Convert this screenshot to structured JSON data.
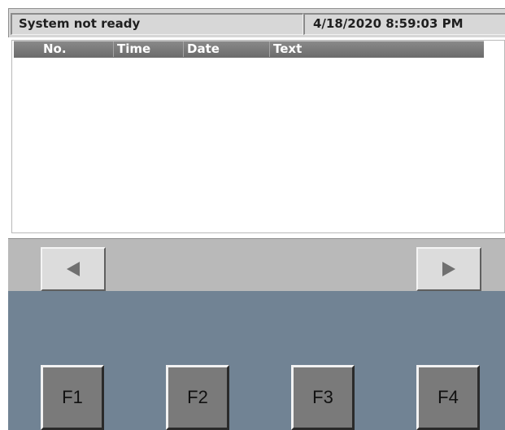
{
  "status_bar": {
    "status_text": "System not ready",
    "datetime": "4/18/2020 8:59:03 PM"
  },
  "alarm_table": {
    "columns": [
      "No.",
      "Time",
      "Date",
      "Text"
    ],
    "rows": []
  },
  "navigation": {
    "prev_icon": "triangle-left-icon",
    "next_icon": "triangle-right-icon"
  },
  "function_keys": [
    "F1",
    "F2",
    "F3",
    "F4"
  ],
  "colors": {
    "panel_background": "#718394",
    "header_background": "#7a7a7a",
    "status_background": "#d6d6d6"
  }
}
